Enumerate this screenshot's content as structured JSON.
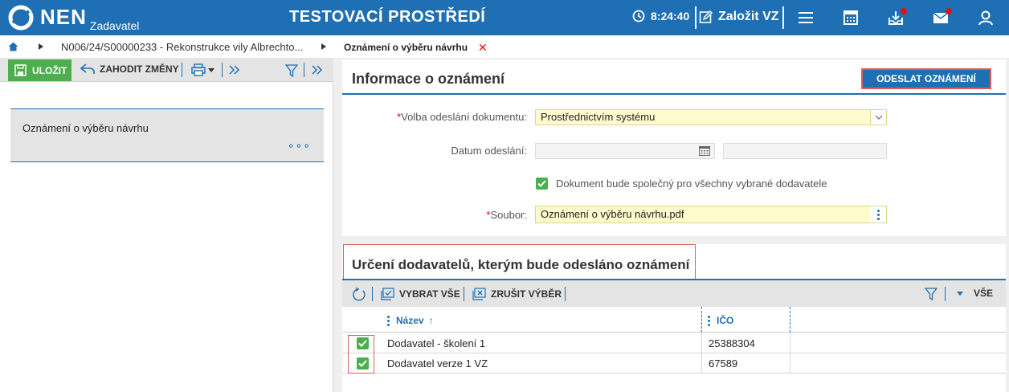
{
  "header": {
    "logo_text": "NEN",
    "logo_sub": "Zadavatel",
    "env_title": "TESTOVACÍ PROSTŘEDÍ",
    "clock": "8:24:40",
    "create_label": "Založit VZ",
    "icons": [
      "clock-icon",
      "edit-icon",
      "menu-icon",
      "calendar-icon",
      "inbox-icon",
      "mail-icon",
      "user-icon"
    ],
    "accent": "#1e6fb4",
    "alert_color": "#e0101b"
  },
  "breadcrumb": {
    "path": "N006/24/S00000233 - Rekonstrukce vily Albrechto..."
  },
  "tab": {
    "label": "Oznámení o výběru návrhu"
  },
  "left_toolbar": {
    "save_label": "ULOŽIT",
    "discard_label": "ZAHODIT ZMĚNY"
  },
  "left_card": {
    "title": "Oznámení o výběru návrhu",
    "more": "∘∘∘"
  },
  "info_panel": {
    "title": "Informace o oznámení",
    "send_label": "ODESLAT OZNÁMENÍ",
    "fields": {
      "send_method_label": "Volba odeslání dokumentu:",
      "send_method_value": "Prostřednictvím systému",
      "date_label": "Datum odeslání:",
      "common_doc_label": "Dokument bude společný pro všechny vybrané dodavatele",
      "file_label": "Soubor:",
      "file_value": "Oznámení o výběru návrhu.pdf"
    }
  },
  "suppliers": {
    "title": "Určení dodavatelů, kterým bude odesláno oznámení",
    "select_all_label": "VYBRAT VŠE",
    "deselect_label": "ZRUŠIT VÝBĚR",
    "all_label": "VŠE",
    "columns": [
      "Název",
      "IČO"
    ],
    "sort_arrow": "↑",
    "rows": [
      {
        "name": "Dodavatel - školení 1",
        "ico": "25388304",
        "checked": true
      },
      {
        "name": "Dodavatel verze 1 VZ",
        "ico": "67589",
        "checked": true
      }
    ]
  }
}
